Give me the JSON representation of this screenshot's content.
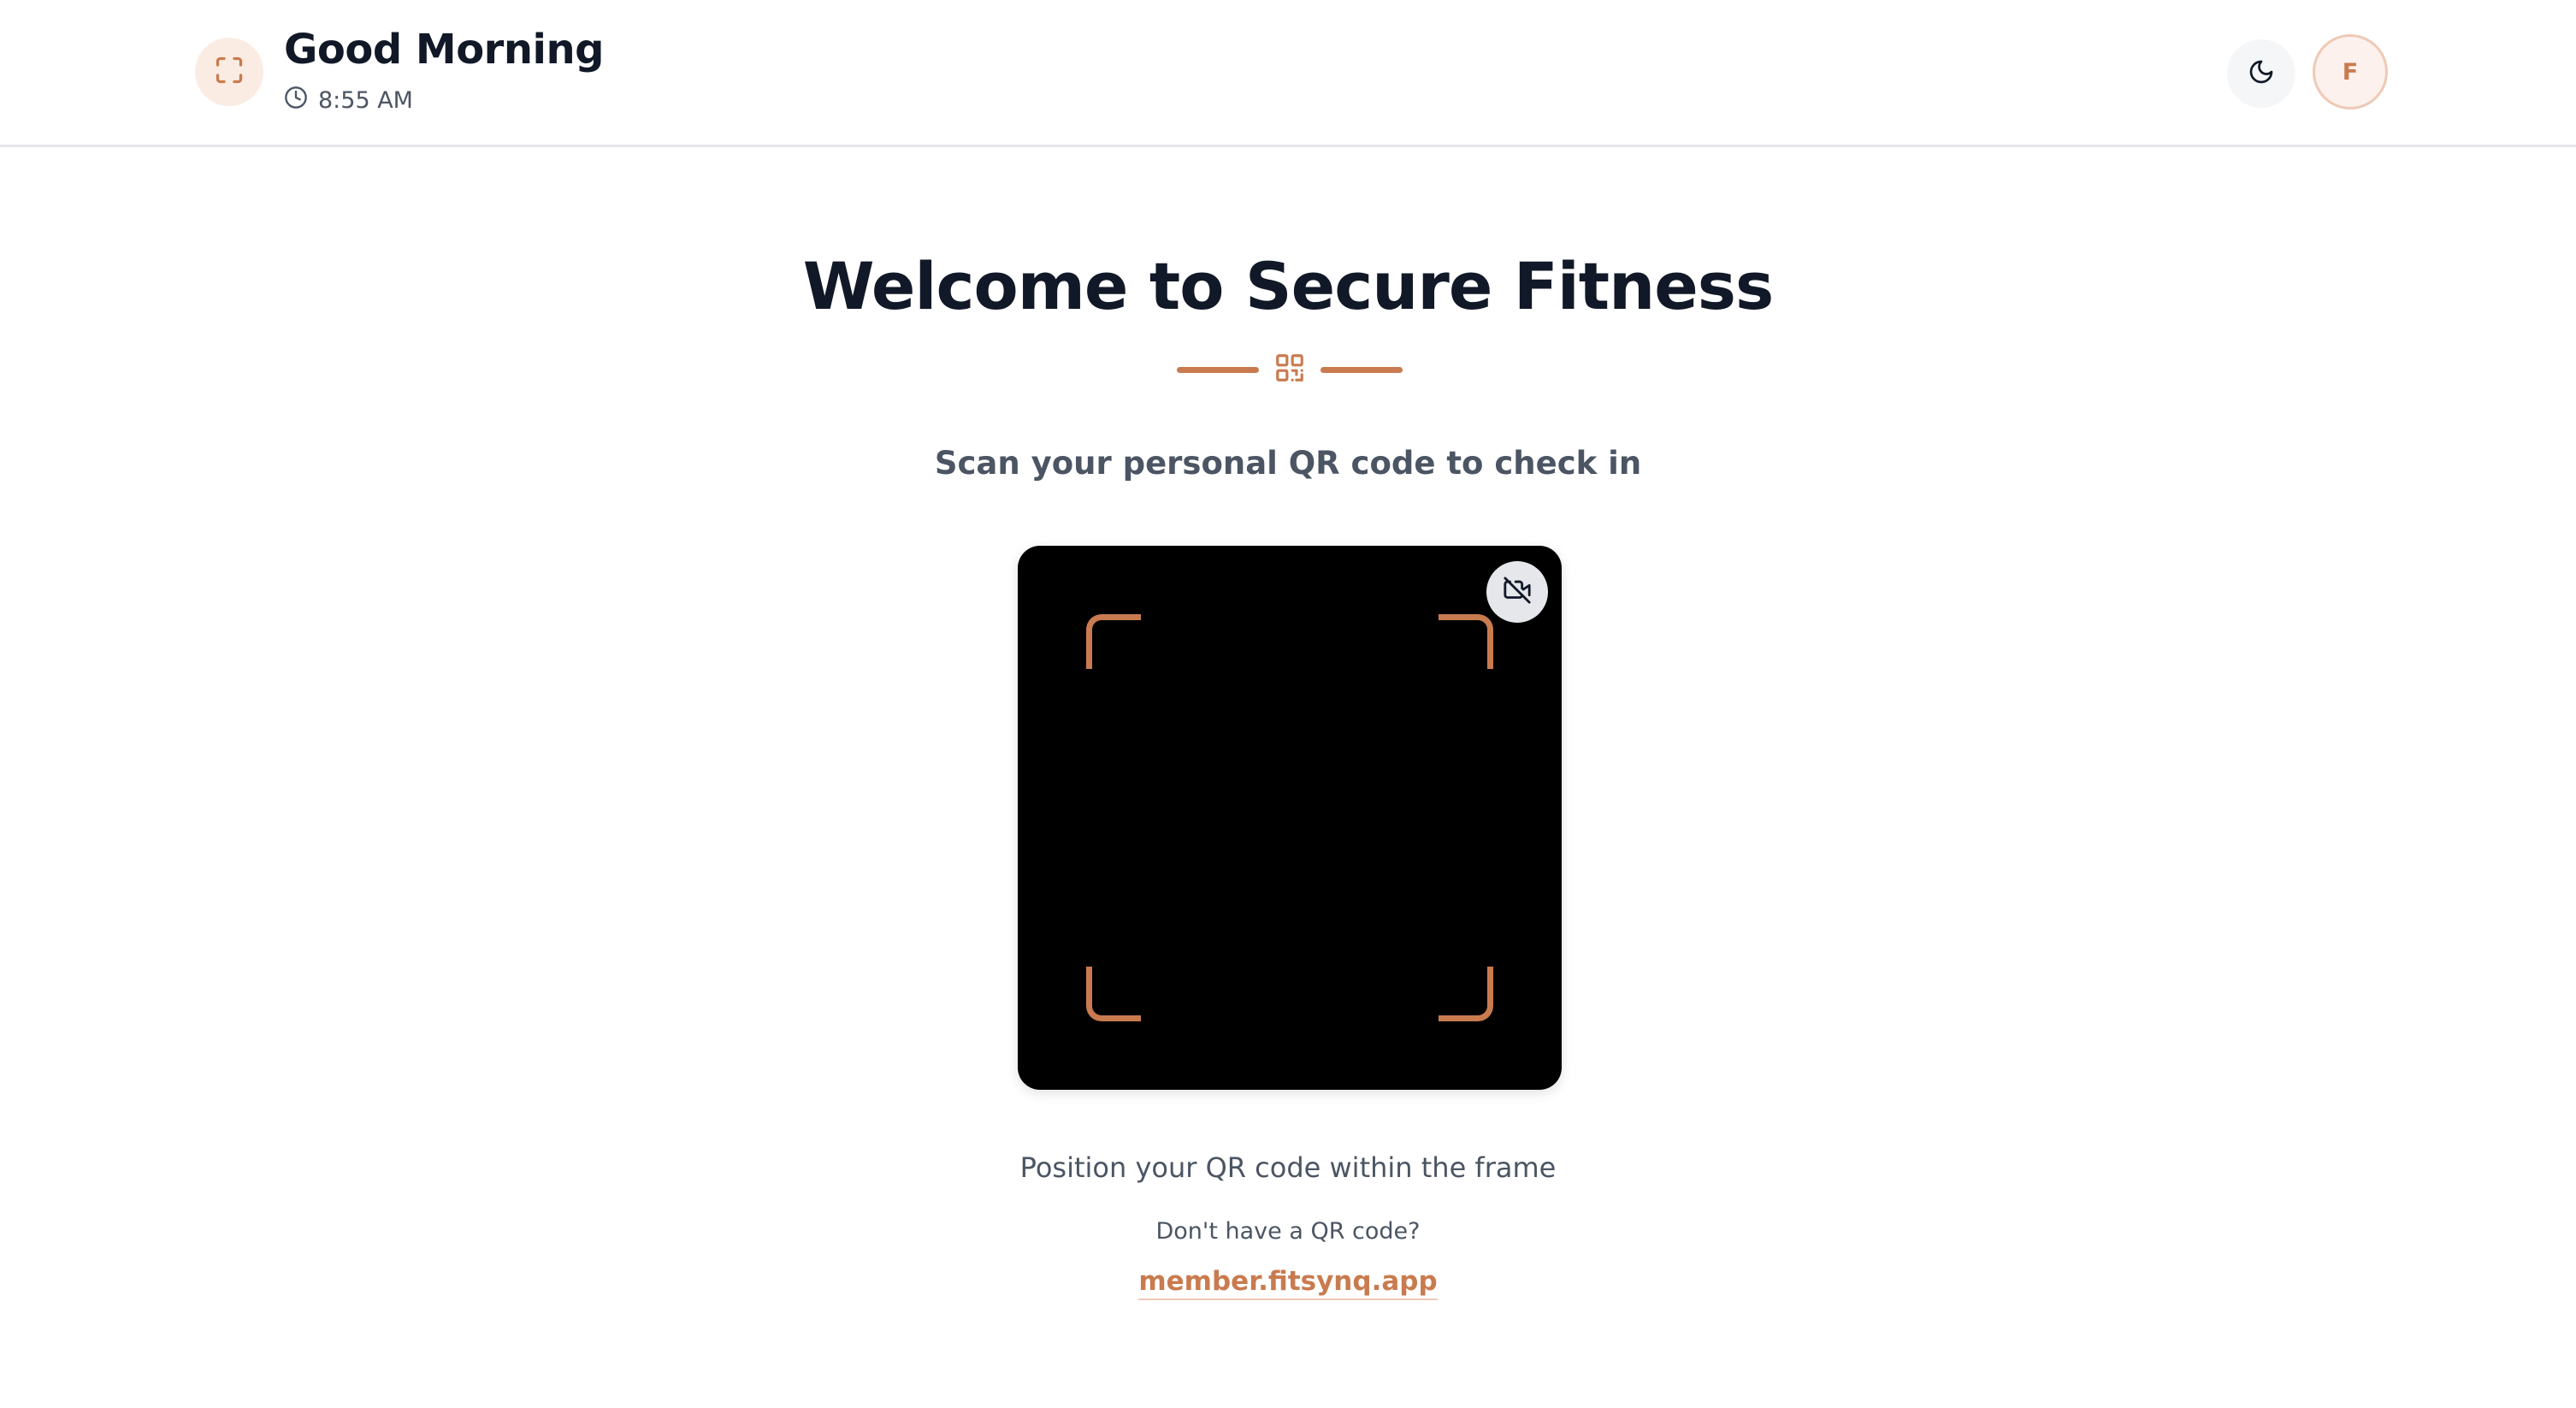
{
  "header": {
    "greeting": "Good Morning",
    "time": "8:55 AM",
    "fullscreen_icon": "fullscreen-icon",
    "clock_icon": "clock-icon",
    "theme_icon": "moon-icon",
    "avatar_initial": "F"
  },
  "main": {
    "title": "Welcome to Secure Fitness",
    "divider_icon": "qr-code-icon",
    "subtitle": "Scan your personal QR code to check in",
    "scanner": {
      "camera_toggle_icon": "camera-off-icon"
    },
    "instruction": "Position your QR code within the frame",
    "no_qr_text": "Don't have a QR code?",
    "member_link": "member.fitsynq.app"
  },
  "colors": {
    "accent": "#c97b4f",
    "accent_light": "#fbece3",
    "text_primary": "#111827",
    "text_secondary": "#4b5563",
    "scanner_bg": "#000000"
  }
}
